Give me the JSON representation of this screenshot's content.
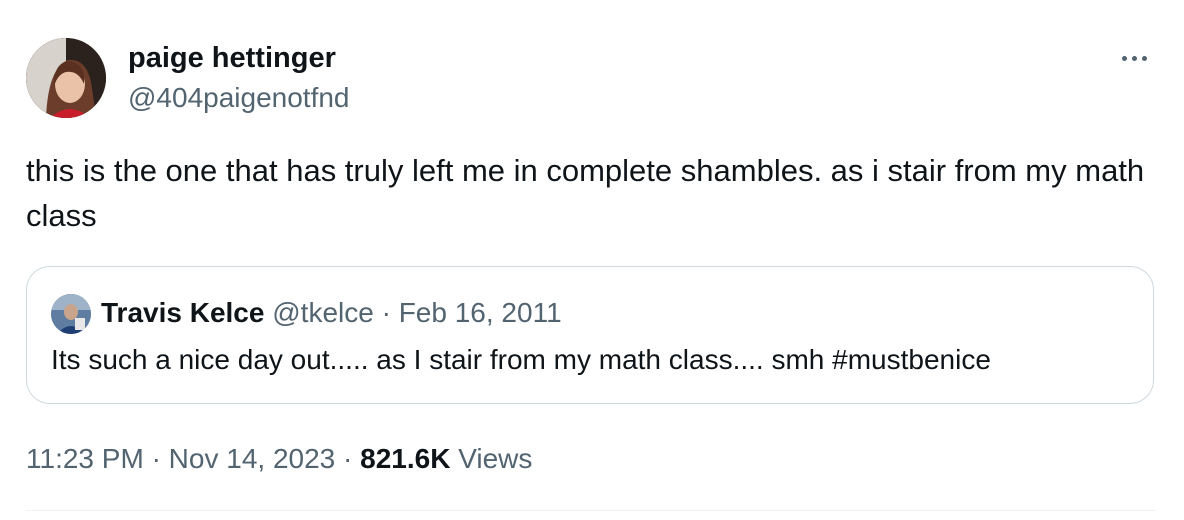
{
  "author": {
    "display_name": "paige hettinger",
    "handle": "@404paigenotfnd"
  },
  "more_icon": "more-horizontal-icon",
  "tweet": {
    "text": "this is the one that has truly left me in complete shambles. as i stair from my math class",
    "time": "11:23 PM",
    "date": "Nov 14, 2023",
    "views_count": "821.6K",
    "views_label": "Views",
    "separator": "·"
  },
  "quoted_tweet": {
    "display_name": "Travis Kelce",
    "handle": "@tkelce",
    "separator": "·",
    "date": "Feb 16, 2011",
    "text": "Its such a nice day out..... as I stair from my math class.... smh #mustbenice"
  }
}
